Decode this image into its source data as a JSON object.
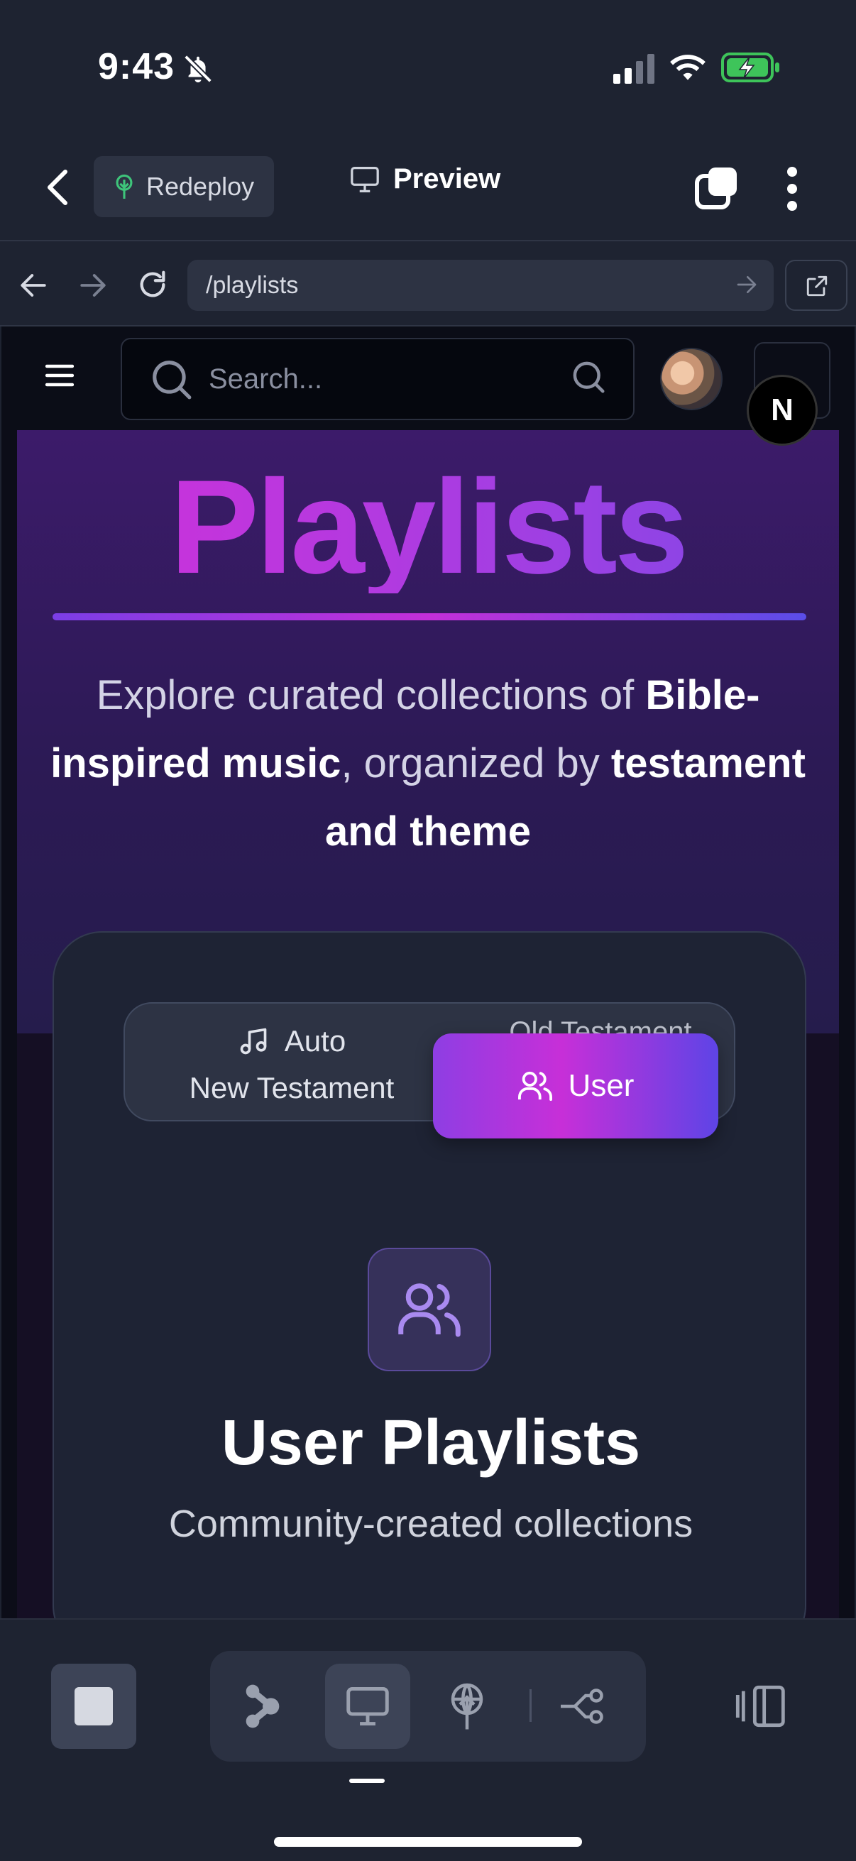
{
  "status_bar": {
    "time": "9:43"
  },
  "app_bar": {
    "redeploy_label": "Redeploy",
    "preview_label": "Preview"
  },
  "url_bar": {
    "url": "/playlists"
  },
  "site_header": {
    "search_placeholder": "Search...",
    "badge_letter": "N"
  },
  "hero": {
    "title": "Playlists",
    "subtitle_1": "Explore curated collections of ",
    "subtitle_bold_1": "Bible-inspired music",
    "subtitle_2": ", organized by ",
    "subtitle_bold_2": "testament and theme"
  },
  "tabs": {
    "auto_label": "Auto",
    "new_testament_label": "New Testament",
    "old_testament_label": "Old Testament",
    "user_label": "User",
    "selected": "User"
  },
  "section": {
    "title": "User Playlists",
    "description": "Community-created collections"
  },
  "colors": {
    "accent_purple": "#8e3ee3",
    "accent_magenta": "#c72fd8",
    "accent_indigo": "#5e44e6",
    "background": "#1e2331"
  },
  "icons": {
    "status": [
      "bell-slash-icon",
      "cellular-signal-icon",
      "wifi-icon",
      "battery-charging-icon"
    ],
    "app_bar": [
      "back-chevron-icon",
      "tree-icon",
      "monitor-icon",
      "tabs-icon",
      "more-vertical-icon"
    ],
    "toolbar": [
      "stop-icon",
      "graph-icon",
      "monitor-icon",
      "deploy-icon",
      "flow-icon",
      "panel-icon"
    ]
  }
}
